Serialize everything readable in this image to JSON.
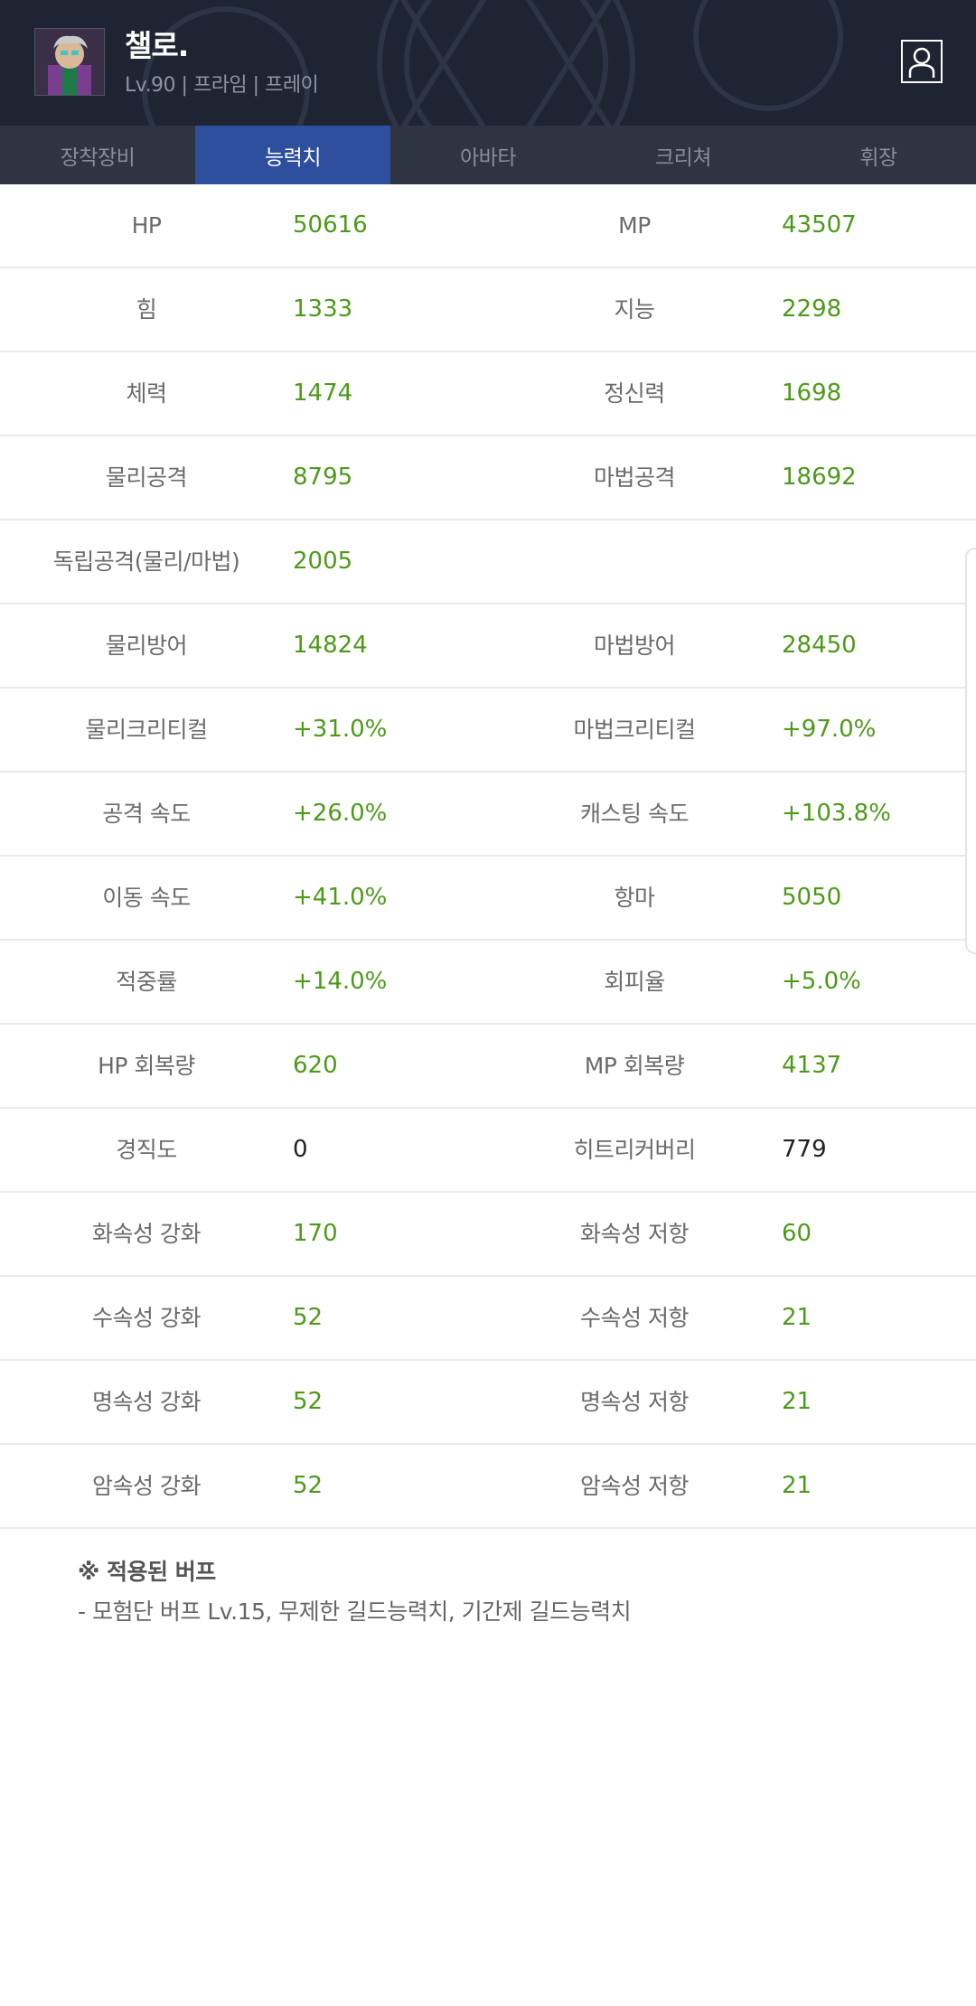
{
  "character": {
    "name": "챌로.",
    "subtitle": "Lv.90 | 프라임 | 프레이"
  },
  "tabs": [
    {
      "label": "장착장비",
      "active": false
    },
    {
      "label": "능력치",
      "active": true
    },
    {
      "label": "아바타",
      "active": false
    },
    {
      "label": "크리쳐",
      "active": false
    },
    {
      "label": "휘장",
      "active": false
    }
  ],
  "stats": [
    {
      "l1": "HP",
      "v1": "50616",
      "l2": "MP",
      "v2": "43507"
    },
    {
      "l1": "힘",
      "v1": "1333",
      "l2": "지능",
      "v2": "2298"
    },
    {
      "l1": "체력",
      "v1": "1474",
      "l2": "정신력",
      "v2": "1698"
    },
    {
      "l1": "물리공격",
      "v1": "8795",
      "l2": "마법공격",
      "v2": "18692"
    },
    {
      "l1": "독립공격(물리/마법)",
      "v1": "2005",
      "l2": "",
      "v2": ""
    },
    {
      "l1": "물리방어",
      "v1": "14824",
      "l2": "마법방어",
      "v2": "28450"
    },
    {
      "l1": "물리크리티컬",
      "v1": "+31.0%",
      "l2": "마법크리티컬",
      "v2": "+97.0%"
    },
    {
      "l1": "공격 속도",
      "v1": "+26.0%",
      "l2": "캐스팅 속도",
      "v2": "+103.8%"
    },
    {
      "l1": "이동 속도",
      "v1": "+41.0%",
      "l2": "항마",
      "v2": "5050"
    },
    {
      "l1": "적중률",
      "v1": "+14.0%",
      "l2": "회피율",
      "v2": "+5.0%"
    },
    {
      "l1": "HP 회복량",
      "v1": "620",
      "l2": "MP 회복량",
      "v2": "4137"
    },
    {
      "l1": "경직도",
      "v1": "0",
      "l2": "히트리커버리",
      "v2": "779"
    },
    {
      "l1": "화속성 강화",
      "v1": "170",
      "l2": "화속성 저항",
      "v2": "60"
    },
    {
      "l1": "수속성 강화",
      "v1": "52",
      "l2": "수속성 저항",
      "v2": "21"
    },
    {
      "l1": "명속성 강화",
      "v1": "52",
      "l2": "명속성 저항",
      "v2": "21"
    },
    {
      "l1": "암속성 강화",
      "v1": "52",
      "l2": "암속성 저항",
      "v2": "21"
    }
  ],
  "buff": {
    "title": "※ 적용된 버프",
    "description": "- 모험단 버프 Lv.15, 무제한 길드능력치, 기간제 길드능력치"
  },
  "colors": {
    "header_bg": "#1e2432",
    "tab_bg": "#2e3441",
    "tab_active": "#2e4f9e",
    "value_green": "#4d9a1a"
  },
  "icons": {
    "profile": "person-icon"
  }
}
